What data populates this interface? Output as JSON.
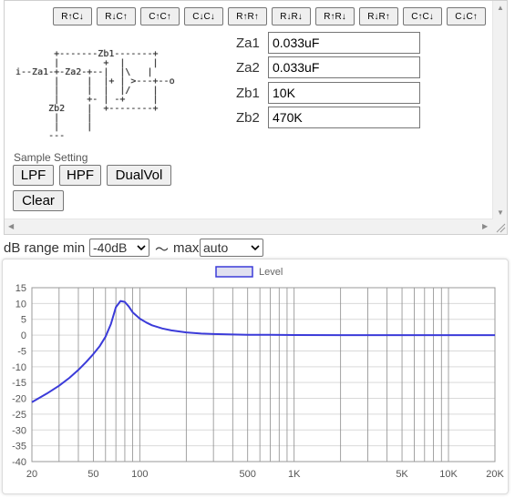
{
  "top_buttons": [
    "R↑C↓",
    "R↓C↑",
    "C↑C↑",
    "C↓C↓",
    "R↑R↑",
    "R↓R↓",
    "R↑R↓",
    "R↓R↑",
    "C↑C↓",
    "C↓C↑"
  ],
  "diagram_text": "       +-------Zb1-------+\n       |        +  |     |\ni--Za1-+-Za2-+--|  |\\   |\n       |     |  |+ | >---+--o\n       |     |  |  |/    |\n       |     +- | -+     |\n      Zb2    |  +--------+\n       |     |\n       |     |\n      ---\n",
  "fields": [
    {
      "label": "Za1",
      "value": "0.033uF"
    },
    {
      "label": "Za2",
      "value": "0.033uF"
    },
    {
      "label": "Zb1",
      "value": "10K"
    },
    {
      "label": "Zb2",
      "value": "470K"
    }
  ],
  "sample_setting_label": "Sample Setting",
  "preset_buttons": [
    "LPF",
    "HPF",
    "DualVol"
  ],
  "clear_label": "Clear",
  "range": {
    "min_label": "dB range min",
    "min_value": "-40dB",
    "tilde": "〜",
    "max_label": "max",
    "max_value": "auto"
  },
  "colors": {
    "line": "#3b3bd9",
    "legend_fill": "#e0e0f0",
    "grid": "#d9d9d9",
    "freq_grid": "#8c8c8c"
  },
  "chart_data": {
    "type": "line",
    "legend_placement": "top-center",
    "grid": true,
    "x_scale": "log",
    "xlim": [
      20,
      20000
    ],
    "ylim": [
      -40,
      15
    ],
    "x_ticks": [
      20,
      50,
      100,
      500,
      1000,
      5000,
      10000,
      20000
    ],
    "x_tick_labels": [
      "20",
      "50",
      "100",
      "500",
      "1K",
      "5K",
      "10K",
      "20K"
    ],
    "y_ticks": [
      15,
      10,
      5,
      0,
      -5,
      -10,
      -15,
      -20,
      -25,
      -30,
      -35,
      -40
    ],
    "series": [
      {
        "name": "Level",
        "x": [
          20,
          25,
          30,
          35,
          40,
          45,
          50,
          55,
          60,
          65,
          70,
          75,
          80,
          85,
          90,
          100,
          110,
          120,
          140,
          160,
          200,
          250,
          300,
          400,
          500,
          700,
          1000,
          2000,
          5000,
          10000,
          20000
        ],
        "y": [
          -21.2,
          -18.5,
          -16,
          -13.5,
          -11,
          -8.5,
          -6,
          -3.5,
          -0.5,
          3.5,
          8.8,
          10.8,
          10.5,
          9,
          7.2,
          5.2,
          4,
          3.1,
          2.1,
          1.5,
          0.85,
          0.5,
          0.35,
          0.2,
          0.12,
          0.07,
          0.04,
          0.01,
          0,
          0,
          0
        ]
      }
    ]
  }
}
